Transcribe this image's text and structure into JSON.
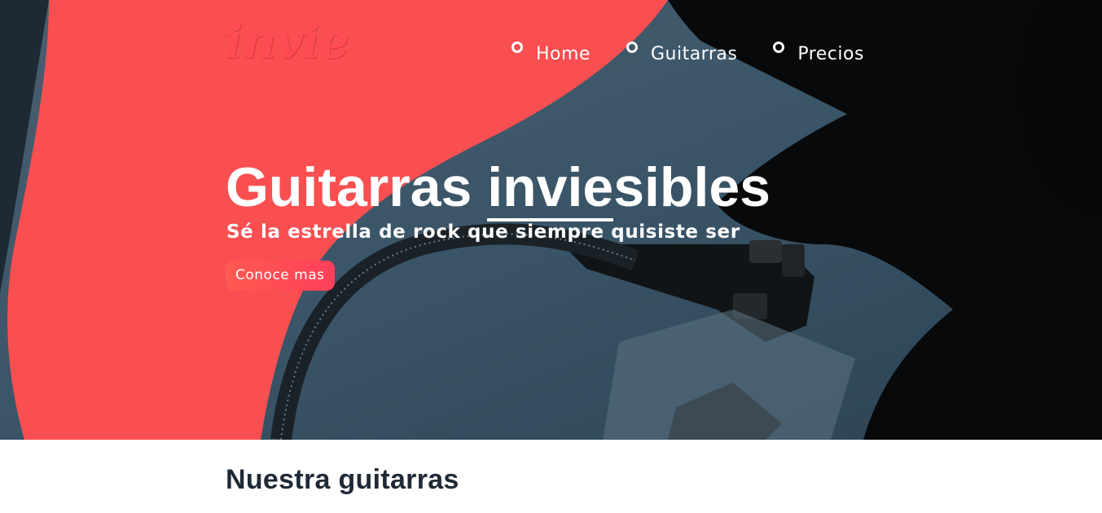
{
  "brand": {
    "logo_text": "invie"
  },
  "nav": {
    "items": [
      {
        "label": "Home"
      },
      {
        "label": "Guitarras"
      },
      {
        "label": "Precios"
      }
    ]
  },
  "hero": {
    "title_prefix": "Guitarras ",
    "title_underlined": "invie",
    "title_suffix": "sibles",
    "subtitle": "Sé la estrella de rock que siempre quisiste ser",
    "cta_label": "Conoce mas"
  },
  "section": {
    "title": "Nuestra guitarras"
  },
  "colors": {
    "accent": "#ff4b52",
    "dark_blue": "#3e5a6e",
    "heading": "#1f2a36"
  }
}
